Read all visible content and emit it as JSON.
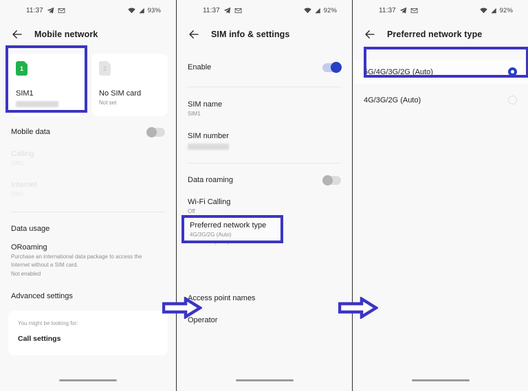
{
  "panels": [
    {
      "status_bar": {
        "time": "11:37",
        "battery": "93%",
        "icons": [
          "telegram-icon",
          "mail-icon",
          "wifi-icon",
          "signal-icon"
        ]
      },
      "app_bar": {
        "back": "back-arrow-icon",
        "title": "Mobile network"
      },
      "sim_cards": [
        {
          "badge": "1",
          "name": "SIM1",
          "sub": "",
          "masked": true,
          "state": "active"
        },
        {
          "badge": "2",
          "name": "No SIM card",
          "sub": "Not set",
          "masked": false,
          "state": "empty"
        }
      ],
      "rows": [
        {
          "title": "Mobile data",
          "sub": "",
          "toggle": "off",
          "dim": false
        },
        {
          "title": "Calling",
          "sub": "SIM1",
          "dim": true
        },
        {
          "title": "Internet",
          "sub": "SIM1",
          "dim": true
        },
        {
          "title": "Data usage",
          "sub": "",
          "dim": false
        },
        {
          "title": "ORoaming",
          "sub": "Purchase an international data package to access the Internet without a SIM card.",
          "sub2": "Not enabled",
          "dim": false
        },
        {
          "title": "Advanced settings",
          "sub": "",
          "dim": false
        }
      ],
      "suggestion_card": {
        "top": "You might be looking for:",
        "main": "Call settings"
      }
    },
    {
      "status_bar": {
        "time": "11:37",
        "battery": "92%"
      },
      "app_bar": {
        "title": "SIM info & settings"
      },
      "rows": [
        {
          "title": "Enable",
          "sub": "",
          "toggle": "on"
        },
        {
          "title": "SIM name",
          "sub": "SIM1"
        },
        {
          "title": "SIM number",
          "sub": "",
          "masked": true
        },
        {
          "title": "Data roaming",
          "sub": "",
          "toggle": "off"
        },
        {
          "title": "Wi-Fi Calling",
          "sub": "Off"
        },
        {
          "title": "Preferred network type",
          "sub": "4G/3G/2G (Auto)",
          "highlighted": true
        },
        {
          "title": "Access point names",
          "sub": ""
        },
        {
          "title": "Operator",
          "sub": ""
        }
      ]
    },
    {
      "status_bar": {
        "time": "11:37",
        "battery": "92%"
      },
      "app_bar": {
        "title": "Preferred network type"
      },
      "options": [
        {
          "label": "5G/4G/3G/2G (Auto)",
          "checked": true,
          "highlighted": true
        },
        {
          "label": "4G/3G/2G (Auto)",
          "checked": false,
          "highlighted": false
        }
      ]
    }
  ],
  "annotations": {
    "arrow_1": "flow-arrow-right",
    "arrow_2": "flow-arrow-right",
    "highlight_color": "#3b35c4"
  }
}
